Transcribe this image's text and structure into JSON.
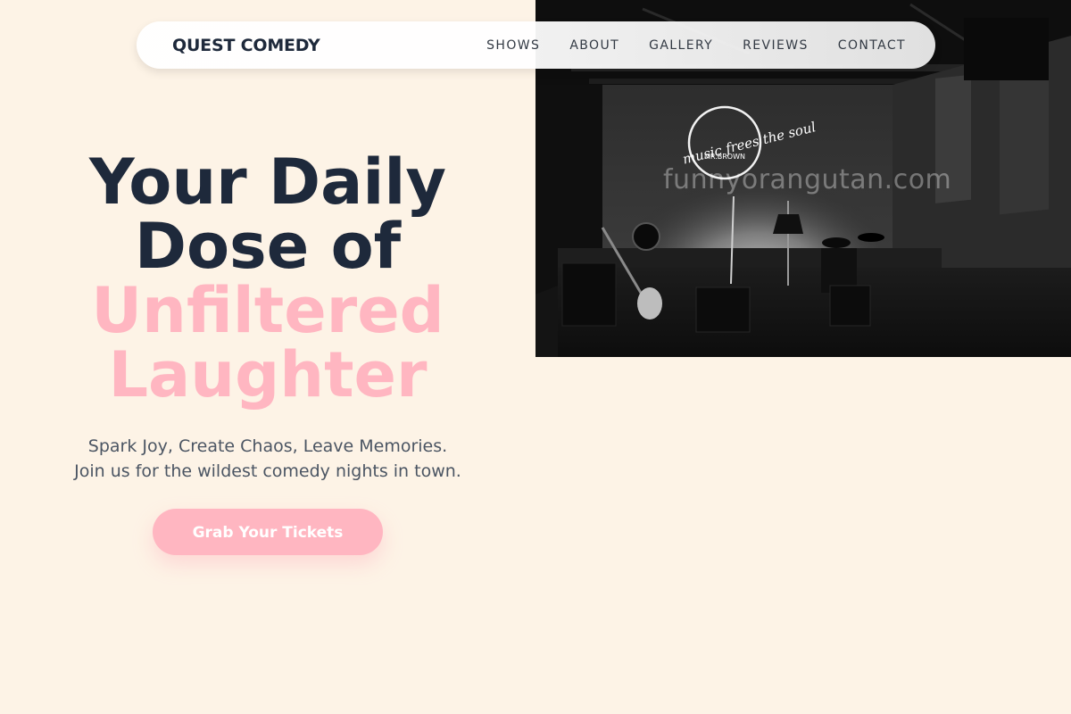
{
  "nav": {
    "brand": "QUEST COMEDY",
    "links": [
      {
        "label": "SHOWS"
      },
      {
        "label": "ABOUT"
      },
      {
        "label": "GALLERY"
      },
      {
        "label": "REVIEWS"
      },
      {
        "label": "CONTACT"
      }
    ]
  },
  "hero": {
    "headline_line1": "Your Daily",
    "headline_line2": "Dose of",
    "headline_accent1": "Unfiltered",
    "headline_accent2": "Laughter",
    "subtitle": "Spark Joy, Create Chaos, Leave Memories. Join us for the wildest comedy nights in town.",
    "cta_label": "Grab Your Tickets"
  },
  "image": {
    "neon_sign_line1": "music frees the soul",
    "neon_sign_line2": "MR.BROWN",
    "watermark": "funnyorangutan.com"
  },
  "colors": {
    "background": "#fdf3e6",
    "accent_pink": "#ffb6c1",
    "heading_dark": "#1e293b",
    "body_text": "#4b5563"
  }
}
